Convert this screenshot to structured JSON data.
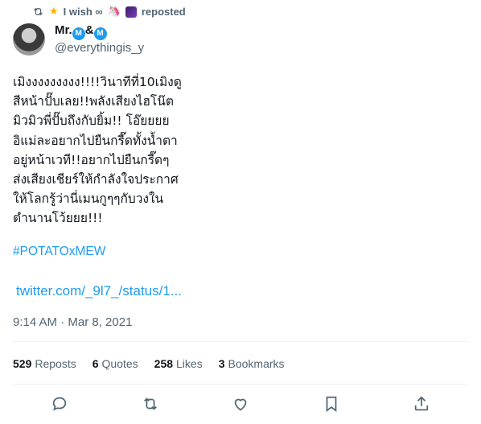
{
  "repost": {
    "label": "I wish ∞",
    "action": "reposted"
  },
  "author": {
    "display_name": "Mr.",
    "separator": "&",
    "badge": "M",
    "handle": "@everythingis_y"
  },
  "tweet": {
    "lines": [
      "เมิงงงงงงงงง!!!!วินาทีที่10เมิงดู",
      "สีหน้าปั๊บเลย!!พลังเสียงไฮโน๊ต",
      "มิวมิวพี่ปั๊บถึงกับยิ้ม!! โอ๊ยยยย",
      "อิแม่ละอยากไปยืนกรี๊ดทั้งน้ำตา",
      "อยู่หน้าเวที!!อยากไปยืนกรี๊ดๆ",
      "ส่งเสียงเชียร์ให้กำลังใจประกาศ",
      "ให้โลกรู้ว่านี่เมนกูๆๆกับวงใน",
      "ตำนานโว้ยยย!!!"
    ],
    "hashtag": "#POTATOxMEW",
    "link": "twitter.com/_9l7_/status/1...",
    "timestamp": "9:14 AM · Mar 8, 2021"
  },
  "stats": [
    {
      "count": "529",
      "label": "Reposts"
    },
    {
      "count": "6",
      "label": "Quotes"
    },
    {
      "count": "258",
      "label": "Likes"
    },
    {
      "count": "3",
      "label": "Bookmarks"
    }
  ],
  "actions": [
    "reply-icon",
    "repost-icon",
    "like-icon",
    "bookmark-icon",
    "share-icon"
  ],
  "colors": {
    "accent": "#1d9bf0",
    "secondary_text": "#536471",
    "divider": "#eff3f4"
  }
}
